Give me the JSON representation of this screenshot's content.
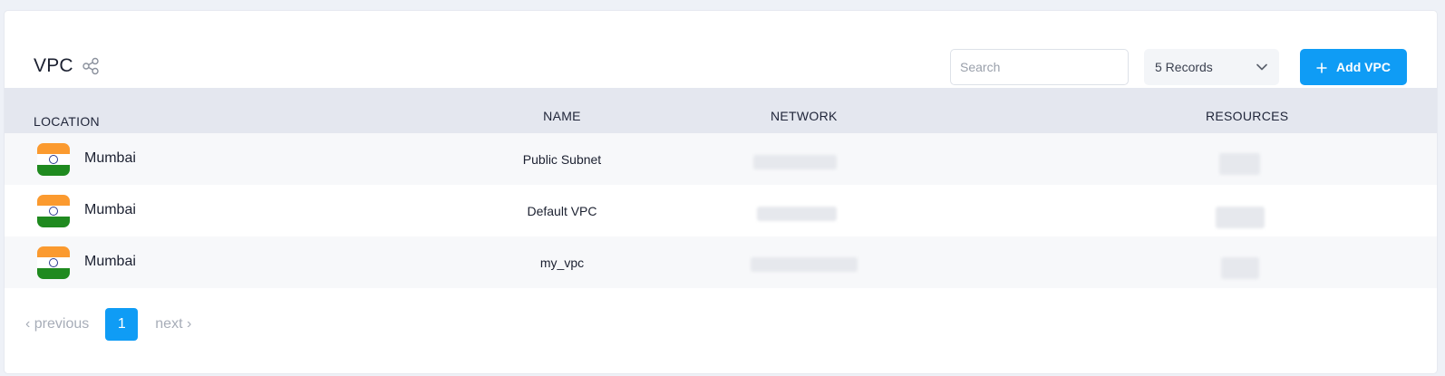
{
  "header": {
    "title": "VPC",
    "search_placeholder": "Search",
    "records_label": "5 Records",
    "add_label": "Add VPC"
  },
  "table": {
    "columns": [
      "LOCATION",
      "NAME",
      "NETWORK",
      "RESOURCES"
    ],
    "rows": [
      {
        "location": "Mumbai",
        "name": "Public Subnet"
      },
      {
        "location": "Mumbai",
        "name": "Default VPC"
      },
      {
        "location": "Mumbai",
        "name": "my_vpc"
      }
    ]
  },
  "pagination": {
    "previous": "previous",
    "current_page": "1",
    "next": "next"
  },
  "icons": {
    "share": "share-icon",
    "chevron": "chevron-down-icon",
    "plus": "plus-icon",
    "flag": "india-flag-icon",
    "prev": "chevron-left-icon",
    "next": "chevron-right-icon"
  },
  "colors": {
    "accent": "#0f9cf5",
    "header_bg": "#e4e7ef"
  }
}
